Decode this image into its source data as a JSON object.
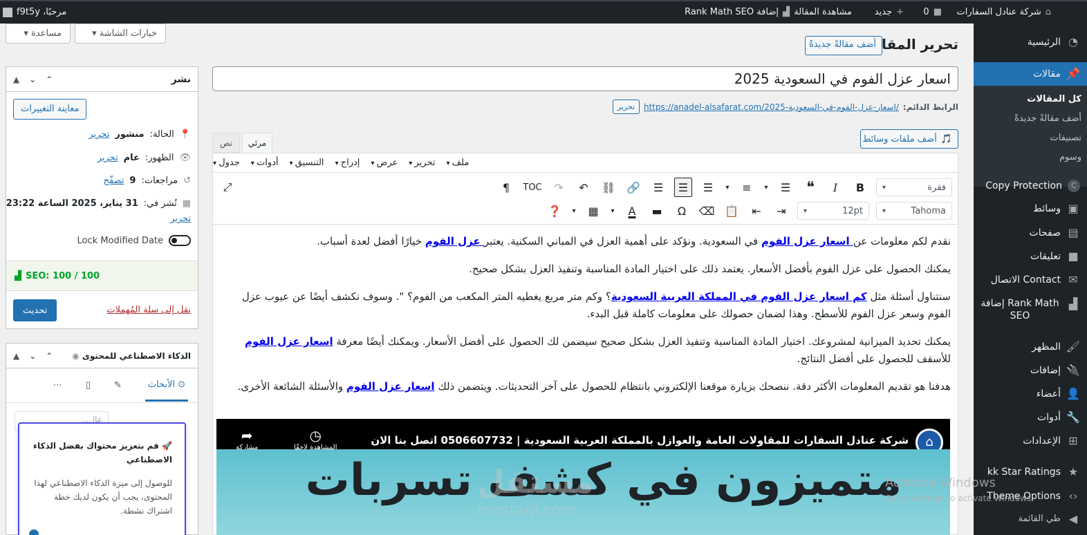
{
  "adminbar": {
    "site_name": "شركة عنادل السفارات",
    "comments_count": "0",
    "new_label": "جديد",
    "view_post": "مشاهدة المقالة",
    "rankmath_add": "Rank Math SEO إضافة",
    "greeting": "مرحبًا، f9t5y"
  },
  "sidebar": {
    "items": [
      {
        "label": "الرئيسية",
        "icon": "dashboard-icon"
      },
      {
        "label": "مقالات",
        "icon": "pin-icon"
      },
      {
        "label": "Copy Protection",
        "icon": "copy-protection-icon"
      },
      {
        "label": "وسائط",
        "icon": "media-icon"
      },
      {
        "label": "صفحات",
        "icon": "pages-icon"
      },
      {
        "label": "تعليقات",
        "icon": "comments-icon"
      },
      {
        "label": "Contact الاتصال",
        "icon": "mail-icon"
      },
      {
        "label": "Rank Math إضافة SEO",
        "icon": "rankmath-icon"
      },
      {
        "label": "المظهر",
        "icon": "appearance-icon"
      },
      {
        "label": "إضافات",
        "icon": "plugins-icon"
      },
      {
        "label": "أعضاء",
        "icon": "users-icon"
      },
      {
        "label": "أدوات",
        "icon": "tools-icon"
      },
      {
        "label": "الإعدادات",
        "icon": "settings-icon"
      },
      {
        "label": "kk Star Ratings",
        "icon": "star-icon"
      },
      {
        "label": "Theme Options",
        "icon": "code-icon"
      },
      {
        "label": "طي القائمة",
        "icon": "collapse-icon"
      }
    ],
    "submenu": [
      "كل المقالات",
      "أضف مقالةً جديدةً",
      "تصنيفات",
      "وسوم"
    ]
  },
  "header": {
    "page_title": "تحرير المقالة",
    "add_new": "أضف مقالةً جديدةً",
    "screen_options": "خيارات الشاشة",
    "help": "مساعدة"
  },
  "post": {
    "title": "اسعار عزل الفوم في السعودية 2025",
    "permalink_label": "الرابط الدائم:",
    "permalink_url": "https://anadel-alsafarat.com/اسعار-عزل-الفوم-في-السعودية-2025/",
    "permalink_edit": "تحرير"
  },
  "editor": {
    "add_media": "أضف ملفات وسائط",
    "tab_visual": "مرئي",
    "tab_text": "نص",
    "menubar": [
      "ملف",
      "تحرير",
      "عرض",
      "إدراج",
      "التنسيق",
      "أدوات",
      "جدول"
    ],
    "format_select": "فقرة",
    "toc_label": "TOC",
    "font_family": "Tahoma",
    "font_size": "12pt",
    "paragraphs": [
      {
        "before": "نقدم لكم معلومات عن",
        "link1": " اسعار عزل الفوم",
        "mid": " في السعودية. ونؤكد على أهمية العزل في المباني السكنية. يعتبر",
        "link2": " عزل الفوم",
        "after": " خيارًا أفضل لعدة أسباب."
      },
      {
        "text": "يمكنك الحصول على عزل الفوم بأفضل الأسعار. يعتمد ذلك على اختيار المادة المناسبة وتنفيذ العزل بشكل صحيح."
      },
      {
        "before": "سنتناول أسئلة مثل ",
        "link1": "كم اسعار عزل الفوم في المملكة العربية السعودية",
        "after": "؟ وكم متر مربع يغطيه المتر المكعب من الفوم؟ \". وسوف نكشف أيضًا عن عيوب عزل الفوم وسعر عزل الفوم للأسطح. وهذا لضمان حصولك على معلومات كاملة قبل البدء."
      },
      {
        "before": "يمكنك تحديد الميزانية لمشروعك. اختيار المادة المناسبة وتنفيذ العزل بشكل صحيح سيضمن لك الحصول على أفضل الأسعار. ويمكنك أيضًا معرفة ",
        "link1": "اسعار عزل الفوم",
        "after": " للأسقف للحصول على أفضل النتائج."
      },
      {
        "before": "هدفنا هو تقديم المعلومات الأكثر دقة. ننصحك بزيارة موقعنا الإلكتروني بانتظام للحصول على آخر التحديثات. ويتضمن ذلك ",
        "link1": "اسعار عزل الفوم",
        "after": " والأسئلة الشائعة الأخرى."
      }
    ],
    "video": {
      "channel_title": "شركة عنادل السفارات للمقاولات العامة والعوازل بالمملكة العربية السعودية | 0506607732 اتصل بنا الان",
      "watch_later": "المشاهدة لاحقًا",
      "share": "مشاركة",
      "banner_text": "متميزون في كشف تسربات"
    }
  },
  "publish": {
    "title": "نشر",
    "preview": "معاينة التغييرات",
    "status_label": "الحالة:",
    "status_value": "منشور",
    "visibility_label": "الظهور:",
    "visibility_value": "عام",
    "revisions_label": "مراجعات:",
    "revisions_value": "9",
    "revisions_link": "تصفّح",
    "published_label": "نُشر في:",
    "published_value": "31 يناير، 2025 الساعة 23:22",
    "edit": "تحرير",
    "lock_modified": "Lock Modified Date",
    "seo_score": "SEO: 100 / 100",
    "trash": "نقل إلى سلة المُهملات",
    "update": "تحديث"
  },
  "ai_box": {
    "title": "الذكاء الاصطناعي للمحتوى",
    "tab_search": "الأبحاث",
    "search_placeholder": "عال...",
    "popup_title": "🚀 قم بتعزيز محتواك بفضل الذكاء الاصطناعي",
    "popup_body": "للوصول إلى ميزة الذكاء الاصطناعي لهذا المحتوى، يجب أن يكون لديك خطة اشتراك نشطة."
  },
  "overlay": {
    "watermark": "مستقل",
    "watermark_sub": "mostaql.com",
    "activate_title": "Activate Windows",
    "activate_sub": "Go to Settings to activate Windows."
  },
  "colors": {
    "accent": "#2271b1",
    "adminbar": "#1d2327",
    "seo_green": "#00a32a",
    "trash_red": "#b32d2e"
  }
}
